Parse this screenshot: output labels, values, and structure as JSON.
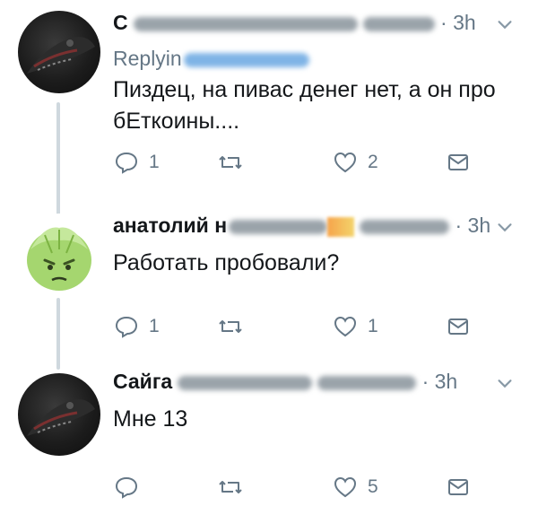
{
  "tweets": [
    {
      "name": "С",
      "time": "· 3h",
      "replying": "Replyin",
      "text": "Пиздец, на пивас денег нет, а он про бЕткоины....",
      "stats": {
        "reply": "1",
        "retweet": "",
        "like": "2"
      }
    },
    {
      "name": "анатолий н",
      "time": "· 3h",
      "text": "Работать пробовали?",
      "stats": {
        "reply": "1",
        "retweet": "",
        "like": "1"
      }
    },
    {
      "name": "Сайга",
      "time": "· 3h",
      "text": "Мне 13",
      "stats": {
        "reply": "",
        "retweet": "",
        "like": "5"
      }
    }
  ],
  "icons": [
    "reply-icon",
    "retweet-icon",
    "like-icon",
    "dm-icon",
    "chevron-down-icon"
  ],
  "colors": {
    "text": "#14171a",
    "muted": "#657786",
    "line": "#cfd8de",
    "avatar_green": "#9ccc65"
  }
}
